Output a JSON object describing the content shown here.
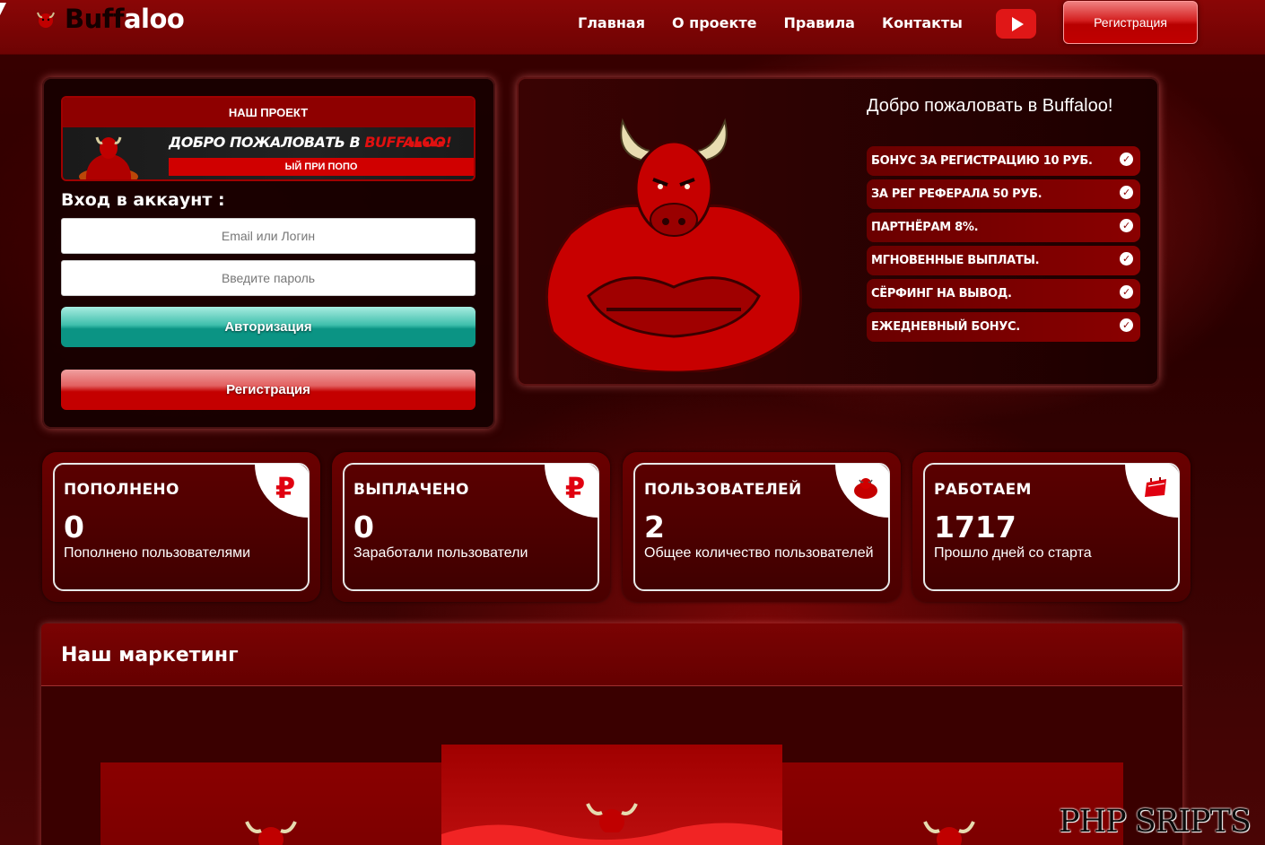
{
  "header": {
    "logo_part1": "Buff",
    "logo_part2": "aloo",
    "nav": [
      "Главная",
      "О проекте",
      "Правила",
      "Контакты"
    ],
    "register_label": "Регистрация"
  },
  "login": {
    "banner_title": "НАШ ПРОЕКТ",
    "banner_welcome": "ДОБРО ПОЖАЛОВАТЬ В",
    "banner_brand": "BUFFALOO!",
    "banner_strip": "ЫЙ ПРИ ПОПО",
    "title": "Вход в аккаунт :",
    "login_placeholder": "Email или Логин",
    "password_placeholder": "Введите пароль",
    "auth_button": "Авторизация",
    "register_button": "Регистрация"
  },
  "welcome": {
    "title": "Добро пожаловать в Buffaloo!",
    "features": [
      "БОНУС ЗА РЕГИСТРАЦИЮ 10 РУБ.",
      "ЗА РЕГ РЕФЕРАЛА 50 РУБ.",
      "ПАРТНЁРАМ 8%.",
      "МГНОВЕННЫЕ ВЫПЛАТЫ.",
      "СЁРФИНГ НА ВЫВОД.",
      "ЕЖЕДНЕВНЫЙ БОНУС."
    ]
  },
  "stats": [
    {
      "label": "ПОПОЛНЕНО",
      "value": "0",
      "desc": "Пополнено пользователями",
      "icon": "ruble-icon"
    },
    {
      "label": "ВЫПЛАЧЕНО",
      "value": "0",
      "desc": "Заработали пользователи",
      "icon": "ruble-icon"
    },
    {
      "label": "ПОЛЬЗОВАТЕЛЕЙ",
      "value": "2",
      "desc": "Общее количество пользователей",
      "icon": "users-icon"
    },
    {
      "label": "РАБОТАЕМ",
      "value": "1717",
      "desc": "Прошло дней со старта",
      "icon": "calendar-icon"
    }
  ],
  "marketing": {
    "title": "Наш маркетинг"
  },
  "watermark": "PHP SRIPTS",
  "colors": {
    "brand_red": "#8a0606",
    "accent_red": "#e01717",
    "teal": "#0b9484"
  }
}
